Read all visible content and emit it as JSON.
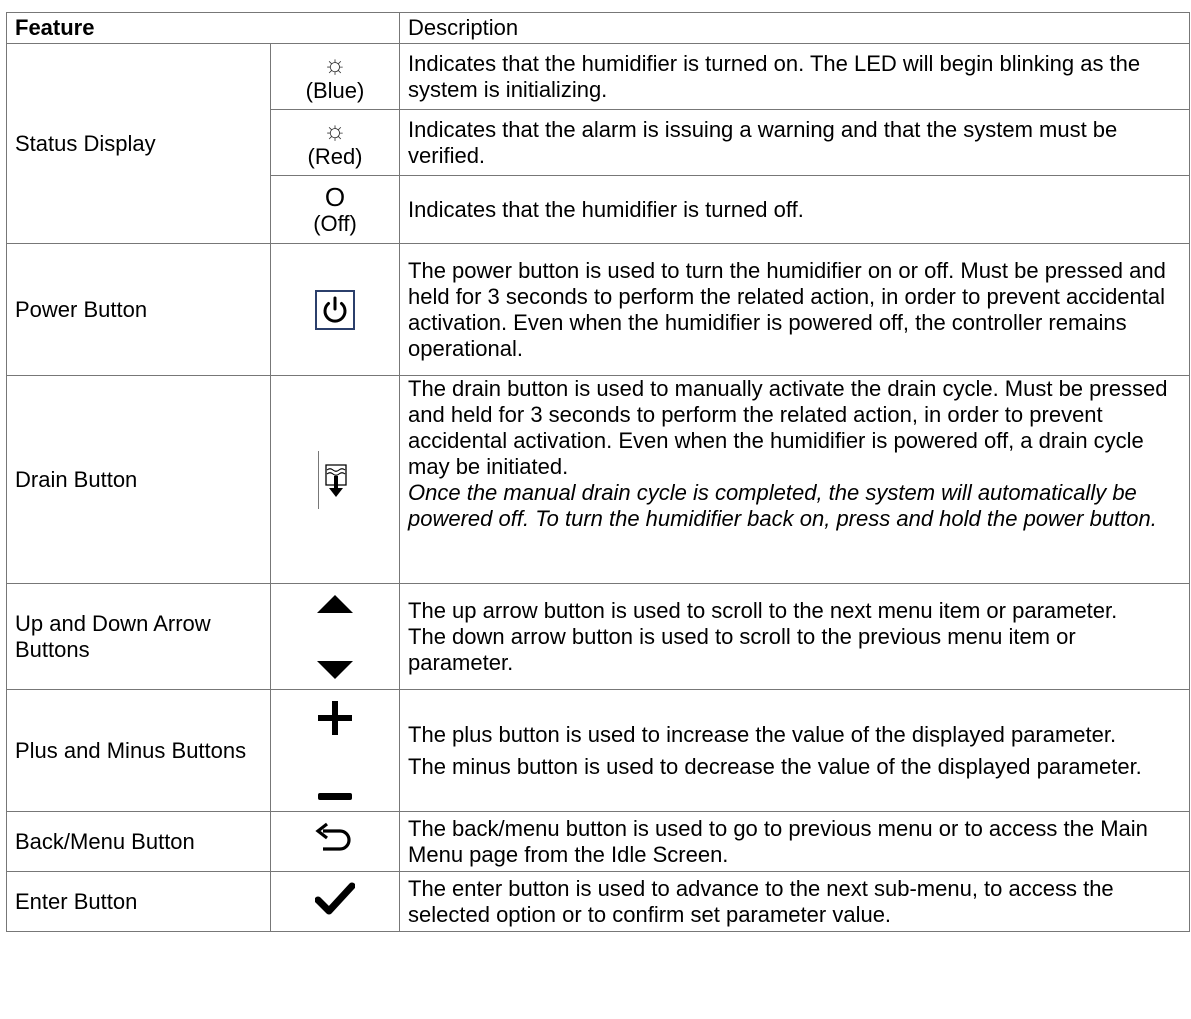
{
  "header": {
    "feature": "Feature",
    "description": "Description"
  },
  "status": {
    "label": "Status Display",
    "blue": {
      "glyph": "☼",
      "caption": "(Blue)",
      "desc": "Indicates that the humidifier is turned on. The LED will begin blinking as the system is initializing."
    },
    "red": {
      "glyph": "☼",
      "caption": "(Red)",
      "desc": "Indicates that the alarm is issuing a warning and that the system must be verified."
    },
    "off": {
      "glyph": "O",
      "caption": "(Off)",
      "desc": "Indicates that the humidifier is turned off."
    }
  },
  "power": {
    "label": "Power Button",
    "icon": "power-icon",
    "desc": "The power button is used to turn the humidifier on or off. Must be pressed and held for 3 seconds to perform the related action, in order to prevent accidental activation. Even when the humidifier is powered off, the controller remains operational."
  },
  "drain": {
    "label": "Drain Button",
    "icon": "drain-icon",
    "desc": "The drain button is used to manually activate the drain cycle. Must be pressed and held for 3 seconds to perform the related action, in order to prevent accidental activation. Even when the humidifier is powered off, a drain cycle may be initiated.",
    "note": "Once the manual drain cycle is completed, the system will automatically be powered off. To turn the humidifier back on, press and hold the power button."
  },
  "arrows": {
    "label": "Up and Down Arrow Buttons",
    "icons": [
      "up-arrow-icon",
      "down-arrow-icon"
    ],
    "up_desc": "The up arrow button is used to scroll to the next menu item or parameter.",
    "down_desc": "The down arrow button is used to scroll to the previous menu item or parameter."
  },
  "plusminus": {
    "label": "Plus and Minus Buttons",
    "icons": [
      "plus-icon",
      "minus-icon"
    ],
    "plus_desc": "The plus button is used to increase the value of the displayed parameter.",
    "minus_desc": "The minus button is used to decrease the value of the displayed parameter."
  },
  "back": {
    "label": "Back/Menu Button",
    "icon": "back-arrow-icon",
    "desc": "The back/menu button is used to go to previous menu or to access the Main Menu page from the Idle Screen."
  },
  "enter": {
    "label": "Enter Button",
    "icon": "checkmark-icon",
    "desc": "The enter button is used to advance to the next sub-menu, to access the selected option or to confirm set parameter value."
  },
  "colors": {
    "border": "#777777",
    "power_box": "#2b3f6b"
  }
}
